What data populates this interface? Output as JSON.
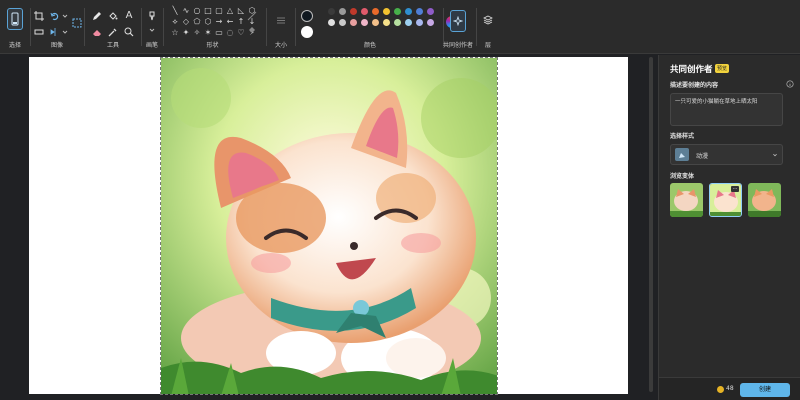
{
  "ribbon": {
    "groups": {
      "selection": "选择",
      "image": "图像",
      "tools": "工具",
      "brushes": "画笔",
      "shapes": "形状",
      "size": "大小",
      "colors": "颜色",
      "cocreator": "共同创作者",
      "layers": "层"
    },
    "text_tool_glyph": "A",
    "shape_glyphs": [
      "╲",
      "∿",
      "○",
      "□",
      "▢",
      "△",
      "◺",
      "⬡",
      "⟡",
      "◇",
      "⬠",
      "⬡",
      "→",
      "←",
      "↑",
      "↓",
      "☆",
      "✦",
      "✧",
      "✶",
      "▭",
      "◌",
      "♡",
      "⚡"
    ],
    "current_colors": {
      "primary": "#101820",
      "secondary": "#ffffff"
    },
    "swatches": [
      "#3a3a3a",
      "#9a9a9a",
      "#c0392b",
      "#e05a6b",
      "#e86a2a",
      "#f2c230",
      "#47b04a",
      "#2f8fd0",
      "#4f7fd6",
      "#8e5bc7",
      "#e0e0e0",
      "#c9c9c9",
      "#e8a0a0",
      "#f0b6c8",
      "#f3c08a",
      "#f5e08a",
      "#b6e0a0",
      "#9cd0f0",
      "#a9b8ee",
      "#c7a9e6"
    ]
  },
  "panel": {
    "title": "共同创作者",
    "badge": "预览",
    "describe_label": "描述要创建的内容",
    "prompt_text": "一只可爱的小猫躺在草地上晒太阳",
    "style_label": "选择样式",
    "style_value": "动漫",
    "variants_label": "浏览变体",
    "variants_more": "…",
    "credits": "48",
    "create_label": "创建"
  }
}
